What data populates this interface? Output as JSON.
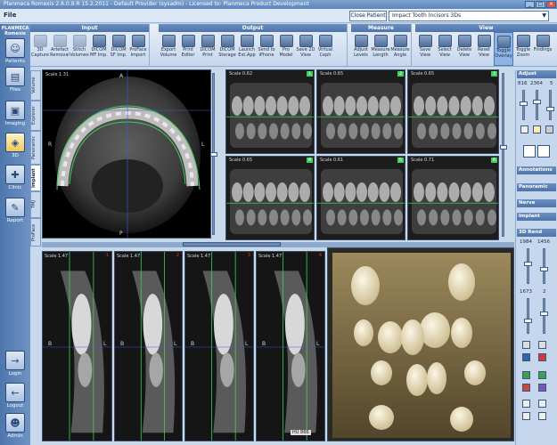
{
  "window": {
    "title": "Planmeca Romexis 2.6.0.9.R  15.2.2011 - Default Provider (sysadm) - Licensed to: Planmeca Product Development"
  },
  "menu": {
    "file": "File"
  },
  "header": {
    "close_patient": "Close Patient",
    "patient": "Impact Tooth Incisors 3Ds"
  },
  "ribbon": {
    "input": {
      "title": "Input",
      "buttons": [
        "3D Capture",
        "Artefact Removal",
        "Stitch Volumes",
        "DICOM MF Imp.",
        "DICOM SF Imp.",
        "ProFace Import"
      ]
    },
    "output": {
      "title": "Output",
      "buttons": [
        "Export Volume",
        "Print Editor",
        "DICOM Print",
        "DICOM Storage",
        "Launch Ext.App",
        "Send to iPhone",
        "Pro Model",
        "Save 2D View",
        "Virtual Ceph"
      ]
    },
    "measure": {
      "title": "Measure",
      "buttons": [
        "Adjust Levels",
        "Measure Length",
        "Measure Angle"
      ]
    },
    "view": {
      "title": "View",
      "buttons": [
        "Save View",
        "Select View",
        "Delete View",
        "Reset View",
        "Toggle Overlay",
        "Toggle Zoom",
        "Findings"
      ]
    }
  },
  "nav": {
    "brand": "PLANMECA Romexis",
    "items": [
      "Patients",
      "Files",
      "Imaging",
      "3D",
      "Clinic",
      "Report",
      "Login",
      "Logout",
      "Admin"
    ]
  },
  "tabs": [
    "Volume",
    "Explorer",
    "Panoramic",
    "Implant",
    "TMJ",
    "ProFace"
  ],
  "axial": {
    "scale": "Scale 1.31",
    "top": "A",
    "left": "R",
    "right": "L",
    "bottom": "P"
  },
  "sections": [
    {
      "scale": "Scale 0.62",
      "num": "1"
    },
    {
      "scale": "Scale 0.65",
      "num": "2"
    },
    {
      "scale": "Scale 0.65",
      "num": "3"
    },
    {
      "scale": "Scale 0.65",
      "num": "4"
    },
    {
      "scale": "Scale 0.61",
      "num": "5"
    },
    {
      "scale": "Scale 0.71",
      "num": "6"
    }
  ],
  "cross": [
    {
      "scale": "Scale 1.47",
      "num": "1"
    },
    {
      "scale": "Scale 1.47",
      "num": "2"
    },
    {
      "scale": "Scale 1.47",
      "num": "3"
    },
    {
      "scale": "Scale 1.47",
      "num": "4"
    }
  ],
  "cross_marks": {
    "b": "B",
    "l": "L",
    "hu": "HU 866"
  },
  "right": {
    "adjust": "Adjust",
    "adjust_vals": [
      "816",
      "2364",
      "5"
    ],
    "annotations": "Annotations",
    "panoramic": "Panoramic",
    "nerve": "Nerve",
    "implant": "Implant",
    "rend": "3D Rend",
    "rend_vals": [
      "1984",
      "1456",
      "1673",
      "2"
    ]
  },
  "colors": {
    "accent": "#4d73a8",
    "marker_green": "#3fcf5a",
    "marker_red": "#e03030"
  }
}
